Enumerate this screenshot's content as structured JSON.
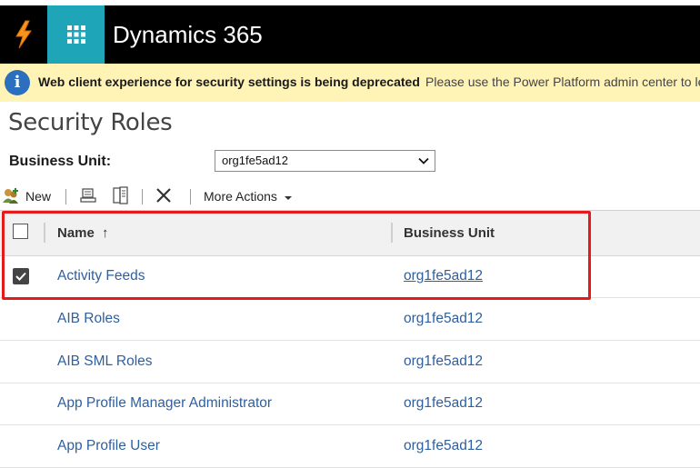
{
  "app": {
    "title": "Dynamics 365"
  },
  "banner": {
    "title": "Web client experience for security settings is being deprecated",
    "message": "Please use the Power Platform admin center to le"
  },
  "page": {
    "title": "Security Roles"
  },
  "business_unit": {
    "label": "Business Unit:",
    "selected": "org1fe5ad12"
  },
  "toolbar": {
    "new_label": "New",
    "more_actions_label": "More Actions"
  },
  "grid": {
    "columns": {
      "name": "Name",
      "sort_indicator": "↑",
      "business_unit": "Business Unit"
    },
    "rows": [
      {
        "name": "Activity Feeds",
        "business_unit": "org1fe5ad12",
        "selected": true
      },
      {
        "name": "AIB Roles",
        "business_unit": "org1fe5ad12",
        "selected": false
      },
      {
        "name": "AIB SML Roles",
        "business_unit": "org1fe5ad12",
        "selected": false
      },
      {
        "name": "App Profile Manager Administrator",
        "business_unit": "org1fe5ad12",
        "selected": false
      },
      {
        "name": "App Profile User",
        "business_unit": "org1fe5ad12",
        "selected": false
      }
    ]
  },
  "colors": {
    "nav_bg": "#000000",
    "waffle_bg": "#1ea5b7",
    "banner_bg": "#fff4b5",
    "link": "#2e5f9e",
    "highlight": "#e51b1b"
  }
}
